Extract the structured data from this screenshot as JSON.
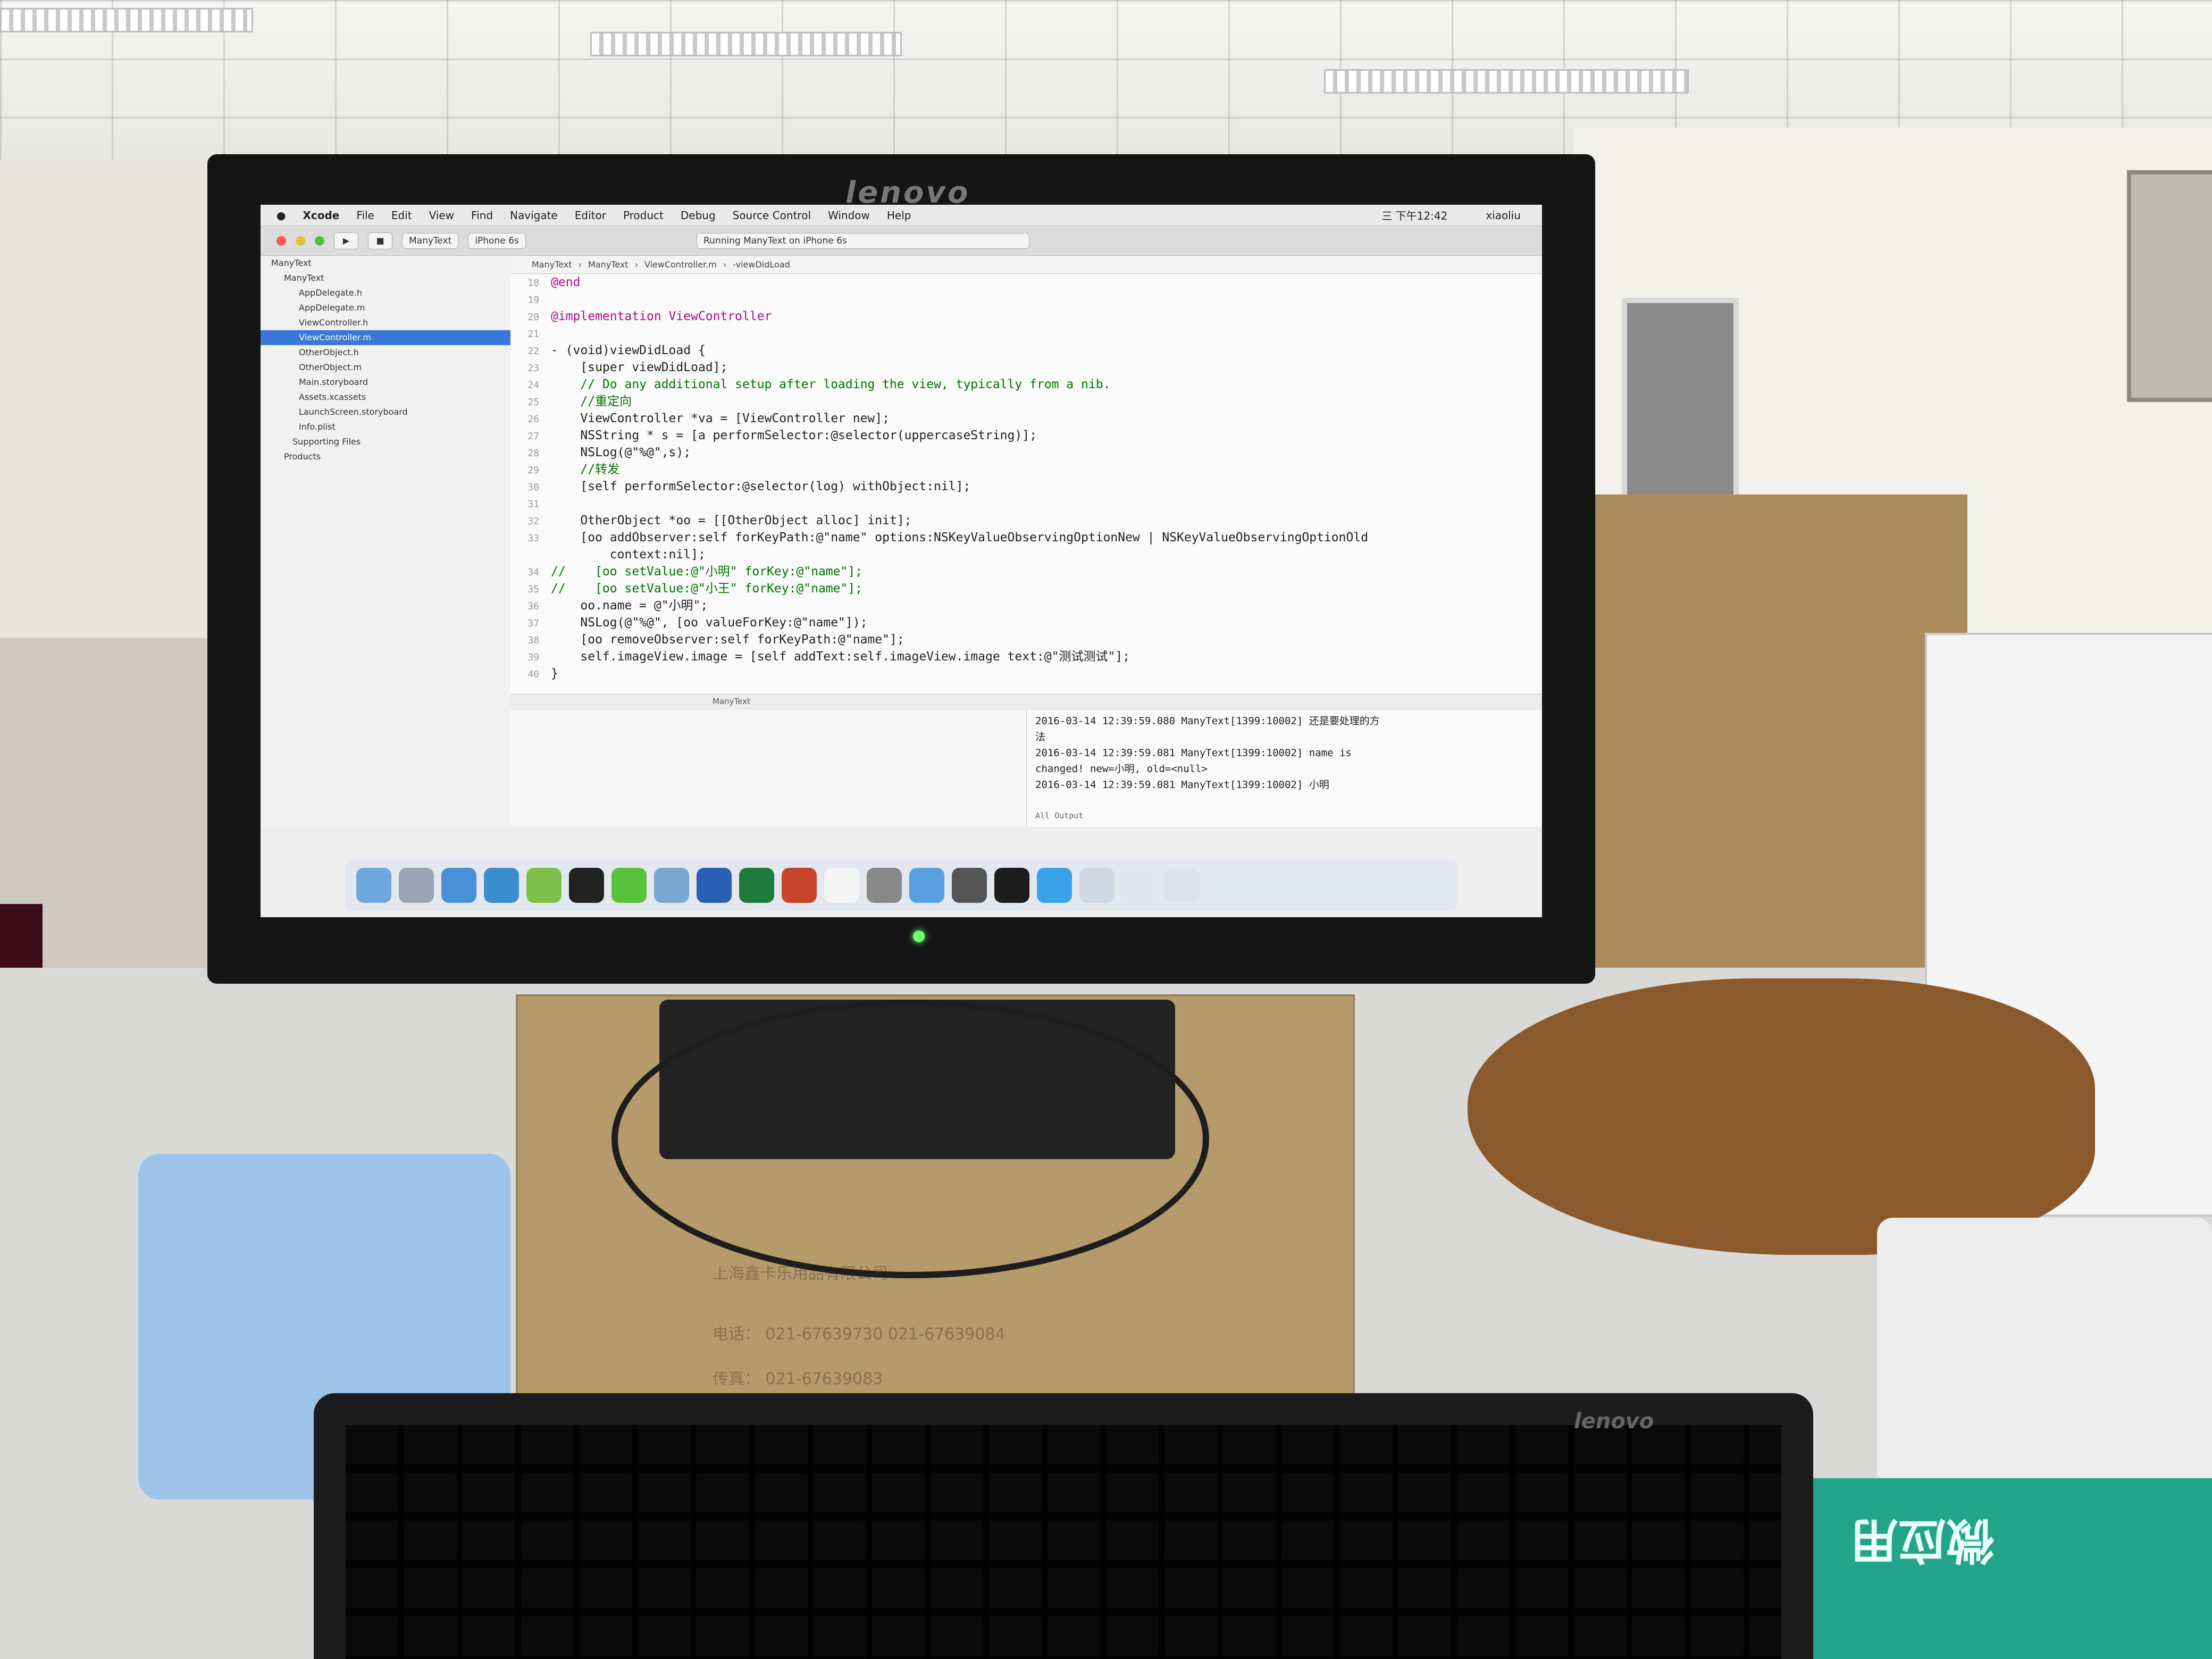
{
  "monitor": {
    "brand": "lenovo"
  },
  "menubar": {
    "items": [
      "Xcode",
      "File",
      "Edit",
      "View",
      "Find",
      "Navigate",
      "Editor",
      "Product",
      "Debug",
      "Source Control",
      "Window",
      "Help"
    ],
    "clock": "三 下午12:42",
    "user": "xiaoliu"
  },
  "toolbar": {
    "scheme": "ManyText",
    "device": "iPhone 6s",
    "status": "Running ManyText on iPhone 6s"
  },
  "navigator": {
    "items": [
      "ManyText",
      "ManyText",
      "AppDelegate.h",
      "AppDelegate.m",
      "ViewController.h",
      "ViewController.m",
      "OtherObject.h",
      "OtherObject.m",
      "Main.storyboard",
      "Assets.xcassets",
      "LaunchScreen.storyboard",
      "Info.plist",
      "Supporting Files",
      "Products"
    ],
    "selected_index": 5
  },
  "jumpbar": {
    "crumbs": [
      "ManyText",
      "ManyText",
      "ViewController.m",
      "-viewDidLoad"
    ]
  },
  "editor": {
    "lines": [
      {
        "n": "18",
        "t": "@end"
      },
      {
        "n": "19",
        "t": ""
      },
      {
        "n": "20",
        "t": "@implementation ViewController"
      },
      {
        "n": "21",
        "t": ""
      },
      {
        "n": "22",
        "t": "- (void)viewDidLoad {"
      },
      {
        "n": "23",
        "t": "    [super viewDidLoad];"
      },
      {
        "n": "24",
        "t": "    // Do any additional setup after loading the view, typically from a nib."
      },
      {
        "n": "25",
        "t": "    //重定向"
      },
      {
        "n": "26",
        "t": "    ViewController *va = [ViewController new];"
      },
      {
        "n": "27",
        "t": "    NSString * s = [a performSelector:@selector(uppercaseString)];"
      },
      {
        "n": "28",
        "t": "    NSLog(@\"%@\",s);"
      },
      {
        "n": "29",
        "t": "    //转发"
      },
      {
        "n": "30",
        "t": "    [self performSelector:@selector(log) withObject:nil];"
      },
      {
        "n": "31",
        "t": ""
      },
      {
        "n": "32",
        "t": "    OtherObject *oo = [[OtherObject alloc] init];"
      },
      {
        "n": "33",
        "t": "    [oo addObserver:self forKeyPath:@\"name\" options:NSKeyValueObservingOptionNew | NSKeyValueObservingOptionOld"
      },
      {
        "n": "",
        "t": "        context:nil];"
      },
      {
        "n": "34",
        "t": "//    [oo setValue:@\"小明\" forKey:@\"name\"];"
      },
      {
        "n": "35",
        "t": "//    [oo setValue:@\"小王\" forKey:@\"name\"];"
      },
      {
        "n": "36",
        "t": "    oo.name = @\"小明\";"
      },
      {
        "n": "37",
        "t": "    NSLog(@\"%@\", [oo valueForKey:@\"name\"]);"
      },
      {
        "n": "38",
        "t": "    [oo removeObserver:self forKeyPath:@\"name\"];"
      },
      {
        "n": "39",
        "t": "    self.imageView.image = [self addText:self.imageView.image text:@\"测试测试\"];"
      },
      {
        "n": "40",
        "t": "}"
      }
    ]
  },
  "debugbar": {
    "target": "ManyText"
  },
  "console": {
    "lines": [
      "2016-03-14 12:39:59.080 ManyText[1399:10002] 还是要处理的方",
      "法",
      "2016-03-14 12:39:59.081 ManyText[1399:10002] name is",
      "changed! new=小明, old=<null>",
      "2016-03-14 12:39:59.081 ManyText[1399:10002] 小明"
    ],
    "filter": "All Output"
  },
  "desk": {
    "box_text": [
      "上海鑫卡乐用品有限公司",
      "电话： 021-67639730  021-67639084",
      "传真： 021-67639083"
    ],
    "keyboard_brand": "lenovo",
    "mat_text": "微应用"
  },
  "colors": {
    "keyword": "#aa0d91",
    "comment": "#007400",
    "string": "#c41a16",
    "selection": "#3b77d8"
  }
}
